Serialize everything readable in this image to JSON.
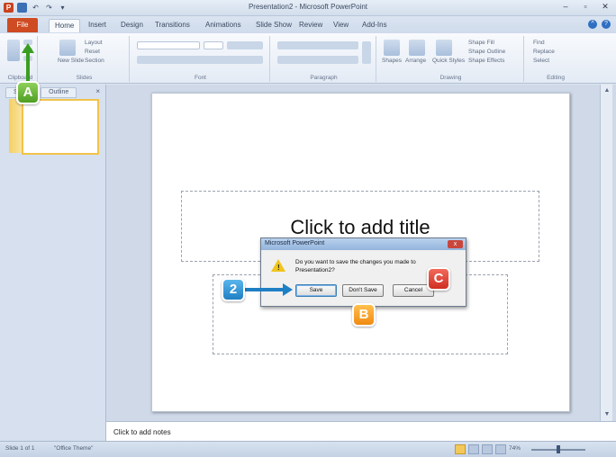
{
  "window": {
    "title": "Presentation2 - Microsoft PowerPoint",
    "controls": [
      "–",
      "▫",
      "✕"
    ]
  },
  "quick_access": [
    "P",
    "💾",
    "↶",
    "↷",
    "▾"
  ],
  "tabs": [
    {
      "label": "File"
    },
    {
      "label": "Home"
    },
    {
      "label": "Insert"
    },
    {
      "label": "Design"
    },
    {
      "label": "Transitions"
    },
    {
      "label": "Animations"
    },
    {
      "label": "Slide Show"
    },
    {
      "label": "Review"
    },
    {
      "label": "View"
    },
    {
      "label": "Add-Ins"
    }
  ],
  "ribbon": {
    "groups": [
      "Clipboard",
      "Slides",
      "Font",
      "Paragraph",
      "Drawing",
      "Editing"
    ],
    "slides_items": [
      "Layout",
      "Reset",
      "Section"
    ],
    "new_slide": "New Slide",
    "drawing_items": [
      "Shape Fill",
      "Shape Outline",
      "Shape Effects"
    ],
    "shapes_labels": [
      "Shapes",
      "Arrange",
      "Quick Styles"
    ],
    "editing_items": [
      "Find",
      "Replace",
      "Select"
    ]
  },
  "left_panel": {
    "tabs": [
      "Slides",
      "Outline"
    ],
    "close": "×"
  },
  "slide": {
    "title_placeholder": "Click to add title"
  },
  "notes": {
    "placeholder": "Click to add notes"
  },
  "status": {
    "slide_info": "Slide 1 of 1",
    "theme": "\"Office Theme\"",
    "zoom": "74%"
  },
  "dialog": {
    "title": "Microsoft PowerPoint",
    "message": "Do you want to save the changes you made to Presentation2?",
    "buttons": {
      "save": "Save",
      "dont_save": "Don't Save",
      "cancel": "Cancel"
    },
    "close": "x"
  },
  "callouts": {
    "a": "A",
    "b": "B",
    "c": "C",
    "step": "2"
  },
  "colors": {
    "file_tab": "#cf4b22",
    "callout_green": "#4e9e22",
    "callout_blue": "#1f7fc4",
    "callout_orange": "#f08a12",
    "callout_red": "#cf2e22"
  }
}
